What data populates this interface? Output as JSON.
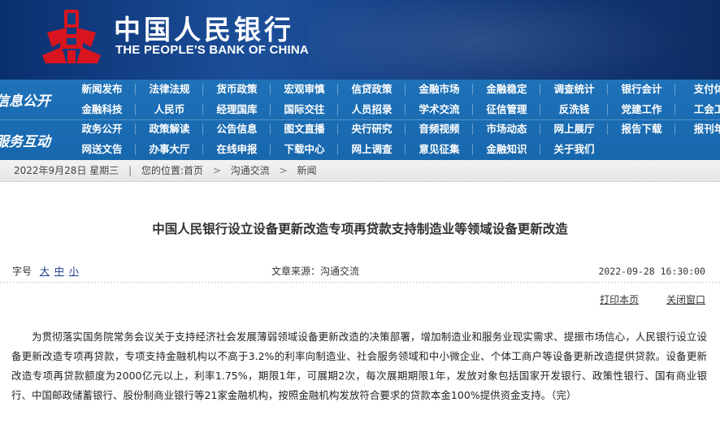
{
  "header": {
    "title_cn": "中国人民银行",
    "title_en": "THE PEOPLE'S BANK OF CHINA",
    "logo_color": "#d8151f"
  },
  "nav": {
    "sections": [
      "信息公开",
      "服务互动"
    ],
    "rows": [
      [
        "新闻发布",
        "法律法规",
        "货币政策",
        "宏观审慎",
        "信贷政策",
        "金融市场",
        "金融稳定",
        "调查统计",
        "银行会计",
        "支付体"
      ],
      [
        "金融科技",
        "人民币",
        "经理国库",
        "国际交往",
        "人员招录",
        "学术交流",
        "征信管理",
        "反洗钱",
        "党建工作",
        "工会工"
      ],
      [
        "政务公开",
        "政策解读",
        "公告信息",
        "图文直播",
        "央行研究",
        "音频视频",
        "市场动态",
        "网上展厅",
        "报告下载",
        "报刊年"
      ],
      [
        "网送文告",
        "办事大厅",
        "在线申报",
        "下载中心",
        "网上调查",
        "意见征集",
        "金融知识",
        "关于我们"
      ]
    ]
  },
  "breadcrumb": {
    "date": "2022年9月28日 星期三",
    "location_label": "您的位置:",
    "items": [
      "首页",
      "沟通交流",
      "新闻"
    ]
  },
  "article": {
    "title": "中国人民银行设立设备更新改造专项再贷款支持制造业等领域设备更新改造",
    "font_size_label": "字号",
    "font_sizes": [
      "大",
      "中",
      "小"
    ],
    "source": "文章来源：沟通交流",
    "datetime": "2022-09-28 16:30:00",
    "print_label": "打印本页",
    "close_label": "关闭窗口",
    "body": "为贯彻落实国务院常务会议关于支持经济社会发展薄弱领域设备更新改造的决策部署，增加制造业和服务业现实需求、提振市场信心，人民银行设立设备更新改造专项再贷款，专项支持金融机构以不高于3.2%的利率向制造业、社会服务领域和中小微企业、个体工商户等设备更新改造提供贷款。设备更新改造专项再贷款额度为2000亿元以上，利率1.75%，期限1年，可展期2次，每次展期期限1年，发放对象包括国家开发银行、政策性银行、国有商业银行、中国邮政储蓄银行、股份制商业银行等21家金融机构，按照金融机构发放符合要求的贷款本金100%提供资金支持。（完）"
  }
}
